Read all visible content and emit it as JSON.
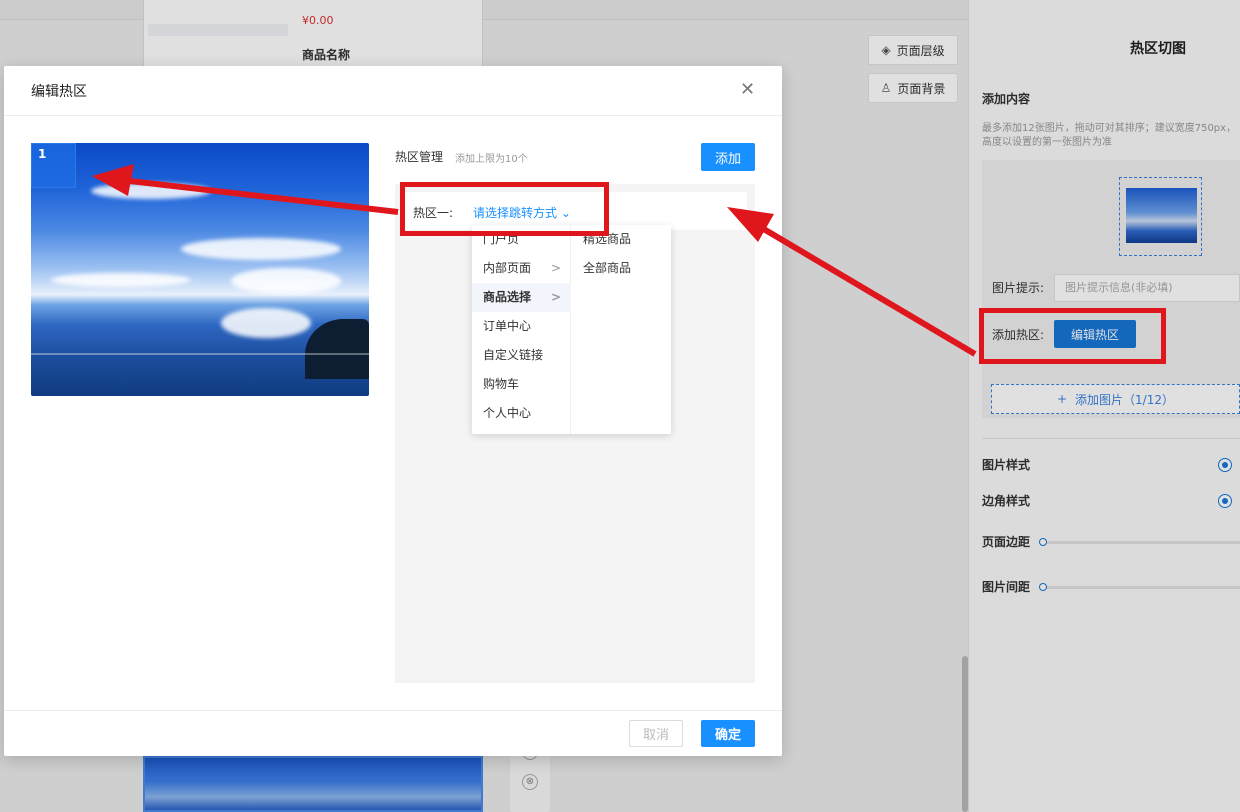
{
  "background_editor": {
    "price": "¥0.00",
    "product_name": "商品名称",
    "toolbar": {
      "layers_label": "页面层级",
      "background_label": "页面背景"
    },
    "panel": {
      "title": "热区切图",
      "add_content": "添加内容",
      "hint": "最多添加12张图片，拖动可对其排序；建议宽度750px，高度以设置的第一张图片为准",
      "image_hint_label": "图片提示:",
      "image_hint_placeholder": "图片提示信息(非必填)",
      "add_hotzone_label": "添加热区:",
      "edit_hotzone_button": "编辑热区",
      "add_image_button": "添加图片（1/12）",
      "image_style_label": "图片样式",
      "corner_style_label": "边角样式",
      "page_margin_label": "页面边距",
      "image_gap_label": "图片间距"
    }
  },
  "modal": {
    "title": "编辑热区",
    "hotzone_number": "1",
    "manage_title": "热区管理",
    "manage_limit": "添加上限为10个",
    "add_button": "添加",
    "hotzone_label": "热区一:",
    "select_placeholder": "请选择跳转方式",
    "cancel_button": "取消",
    "confirm_button": "确定"
  },
  "cascader": {
    "level1": [
      "门户页",
      "内部页面",
      "商品选择",
      "订单中心",
      "自定义链接",
      "购物车",
      "个人中心"
    ],
    "level1_has_children": [
      false,
      true,
      true,
      false,
      false,
      false,
      false
    ],
    "active_index": 2,
    "level2": [
      "精选商品",
      "全部商品"
    ]
  },
  "annotation": {
    "color": "#e0161d"
  }
}
